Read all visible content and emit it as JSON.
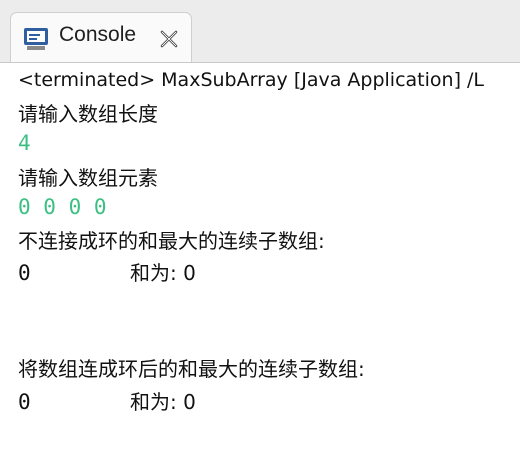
{
  "tab": {
    "icon": "console-icon",
    "title": "Console",
    "close_icon": "close-icon"
  },
  "status": "<terminated> MaxSubArray [Java Application] /L",
  "output": {
    "prompt_length": "请输入数组长度",
    "input_length": "4",
    "prompt_elements": "请输入数组元素",
    "input_elements": "0 0 0 0",
    "heading_linear": "不连接成环的和最大的连续子数组:",
    "linear_subarray": "0",
    "linear_sum": "和为: 0",
    "heading_circular": "将数组连成环后的和最大的连续子数组:",
    "circular_subarray": "0",
    "circular_sum": "和为: 0"
  },
  "colors": {
    "user_input": "#3cbf83",
    "text": "#111111",
    "tabbar_bg": "#ececec",
    "icon_blue": "#2f5f9e"
  }
}
